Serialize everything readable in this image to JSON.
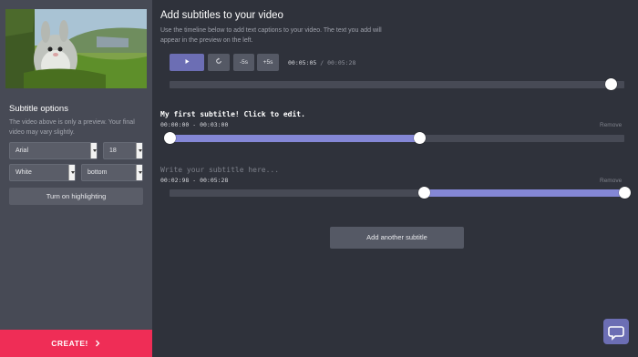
{
  "sidebar": {
    "options_title": "Subtitle options",
    "options_description": "The video above is only a preview. Your final video may vary slightly.",
    "font": "Arial",
    "size": "18",
    "color": "White",
    "position": "bottom",
    "highlight_button": "Turn on highlighting",
    "create_button": "CREATE!",
    "create_icon": "chevron-right-icon"
  },
  "main": {
    "title": "Add subtitles to your video",
    "description": "Use the timeline below to add text captions to your video. The text you add will appear in the preview on the left.",
    "player": {
      "play_icon": "play-icon",
      "replay_icon": "replay-icon",
      "back_label": "-5s",
      "forward_label": "+5s",
      "current_time": "00:05:05",
      "separator": "/",
      "total_time": "00:05:28",
      "progress": 0.97
    },
    "subtitles": [
      {
        "text": "My first subtitle! Click to edit.",
        "placeholder": "",
        "start": "00:00:00",
        "dash": "-",
        "end": "00:03:00",
        "remove": "Remove",
        "range": [
          0,
          0.55
        ]
      },
      {
        "text": "",
        "placeholder": "Write your subtitle here...",
        "start": "00:02:98",
        "dash": "-",
        "end": "00:05:28",
        "remove": "Remove",
        "range": [
          0.56,
          1
        ]
      }
    ],
    "add_button": "Add another subtitle"
  },
  "chat_icon": "chat-bubble-icon",
  "colors": {
    "accent": "#6c6eb4",
    "fill": "#8487d6",
    "create": "#ef2d56"
  }
}
